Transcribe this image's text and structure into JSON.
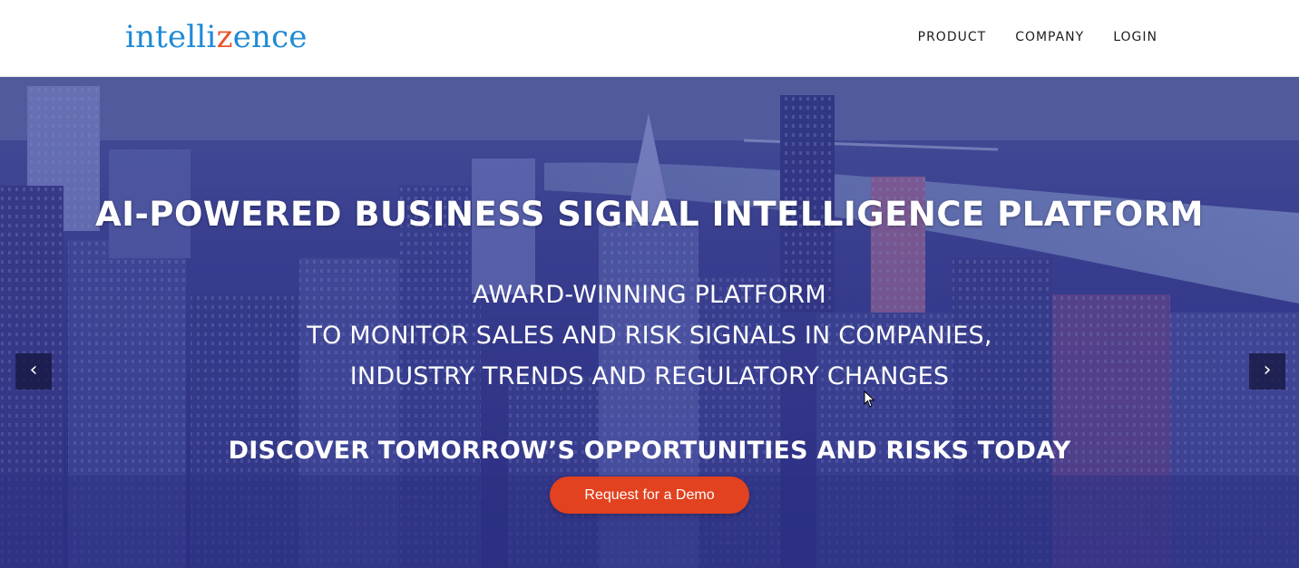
{
  "header": {
    "logo_before": "intelli",
    "logo_accent": "z",
    "logo_after": "ence",
    "nav": [
      {
        "label": "PRODUCT"
      },
      {
        "label": "COMPANY"
      },
      {
        "label": "LOGIN"
      }
    ]
  },
  "hero": {
    "title": "AI-POWERED BUSINESS SIGNAL INTELLIGENCE PLATFORM",
    "subtitle_lines": [
      "AWARD-WINNING PLATFORM",
      "TO MONITOR SALES AND RISK SIGNALS IN COMPANIES,",
      "INDUSTRY TRENDS AND REGULATORY CHANGES"
    ],
    "tagline": "DISCOVER TOMORROW’S OPPORTUNITIES AND RISKS TODAY",
    "cta_label": "Request for a Demo",
    "prev_arrow": "‹",
    "next_arrow": "›"
  },
  "colors": {
    "brand_blue": "#1f8ad6",
    "brand_orange": "#e8542a",
    "cta": "#e2421f",
    "hero_overlay": "#3b3f94"
  },
  "icons": {
    "prev": "chevron-left-icon",
    "next": "chevron-right-icon",
    "cursor": "mouse-pointer-icon"
  }
}
